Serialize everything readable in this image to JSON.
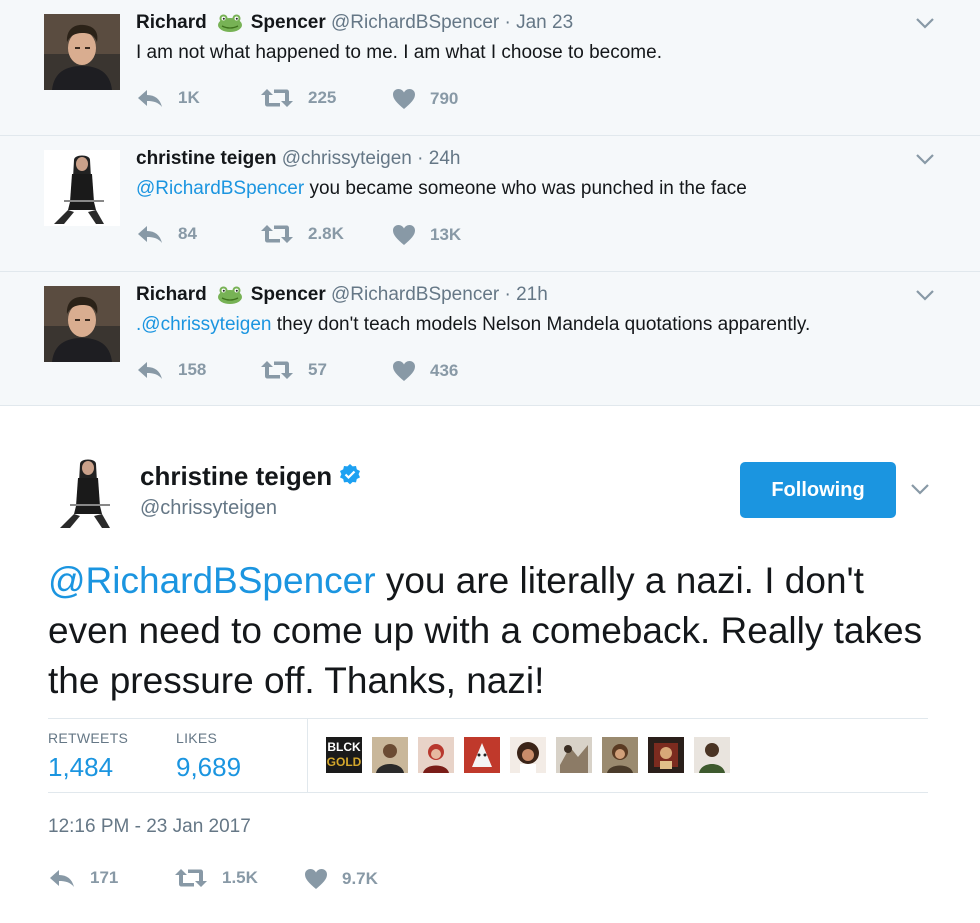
{
  "thread": [
    {
      "name_first": "Richard",
      "name_last": "Spencer",
      "handle_meta": "@RichardBSpencer · Jan 23",
      "mention": "",
      "text": "I am not what happened to me. I am what I choose to become.",
      "reply_count": "1K",
      "retweet_count": "225",
      "like_count": "790"
    },
    {
      "name": "christine teigen",
      "handle_meta": "@chrissyteigen · 24h",
      "mention": "@RichardBSpencer",
      "text": " you became someone who was punched in the face",
      "reply_count": "84",
      "retweet_count": "2.8K",
      "like_count": "13K"
    },
    {
      "name_first": "Richard",
      "name_last": "Spencer",
      "handle_meta": "@RichardBSpencer · 21h",
      "mention": ".@chrissyteigen",
      "text": " they don't teach models Nelson Mandela quotations apparently.",
      "reply_count": "158",
      "retweet_count": "57",
      "like_count": "436"
    }
  ],
  "main": {
    "name": "christine teigen",
    "handle": "@chrissyteigen",
    "follow_label": "Following",
    "mention": "@RichardBSpencer",
    "text": " you are literally a nazi. I don't even need to come up with a comeback. Really takes the pressure off. Thanks, nazi!",
    "retweets_label": "RETWEETS",
    "retweets_value": "1,484",
    "likes_label": "LIKES",
    "likes_value": "9,689",
    "liker_badge_top": "BLCK",
    "liker_badge_bottom": "GOLD",
    "timestamp": "12:16 PM - 23 Jan 2017",
    "reply_count": "171",
    "retweet_count": "1.5K",
    "like_count": "9.7K"
  },
  "icons": [
    "frog-emoji-icon",
    "chevron-down-icon",
    "reply-icon",
    "retweet-icon",
    "heart-icon",
    "verified-badge-icon"
  ],
  "colors": {
    "link": "#1b95e0",
    "muted": "#8899a6",
    "thread_bg": "#f5f8fa",
    "button": "#1b95e0"
  }
}
